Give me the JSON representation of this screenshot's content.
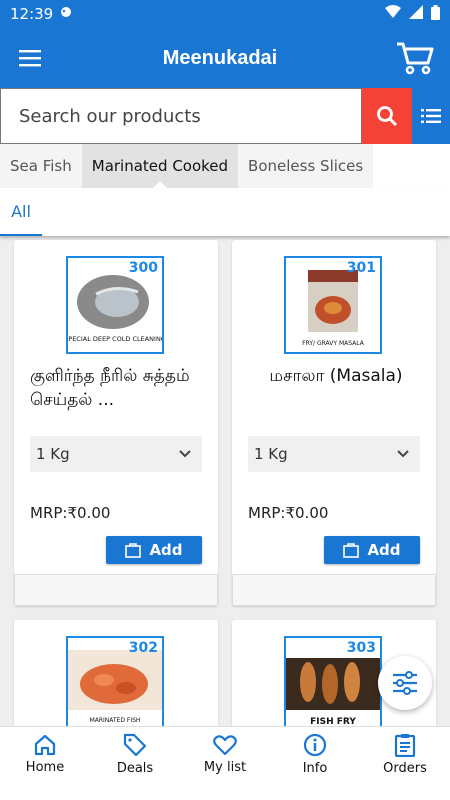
{
  "status": {
    "time": "12:39"
  },
  "app": {
    "title": "Meenukadai"
  },
  "search": {
    "placeholder": "Search our products"
  },
  "category_tabs": [
    {
      "label": "Sea Fish"
    },
    {
      "label": "Marinated Cooked"
    },
    {
      "label": "Boneless Slices"
    }
  ],
  "sub_tabs": [
    {
      "label": "All"
    }
  ],
  "products": [
    {
      "code": "300",
      "name": "குளிர்ந்த நீரில் சுத்தம் செய்தல் ...",
      "image_caption": "SPECIAL DEEP COLD CLEANING",
      "unit": "1 Kg",
      "mrp": "MRP:₹0.00",
      "add_label": "Add"
    },
    {
      "code": "301",
      "name": "மசாலா (Masala)",
      "image_caption": "FRY/ GRAVY MASALA",
      "unit": "1 Kg",
      "mrp": "MRP:₹0.00",
      "add_label": "Add"
    },
    {
      "code": "302",
      "name": "",
      "image_caption": "MARINATED FISH",
      "unit": "",
      "mrp": "",
      "add_label": ""
    },
    {
      "code": "303",
      "name": "",
      "image_caption": "FISH FRY",
      "unit": "",
      "mrp": "",
      "add_label": ""
    }
  ],
  "bottom_nav": [
    {
      "label": "Home",
      "icon": "home-icon"
    },
    {
      "label": "Deals",
      "icon": "tag-icon"
    },
    {
      "label": "My list",
      "icon": "heart-icon"
    },
    {
      "label": "Info",
      "icon": "info-icon"
    },
    {
      "label": "Orders",
      "icon": "clipboard-icon"
    }
  ],
  "colors": {
    "primary": "#1976d2",
    "search_button": "#f44336",
    "badge": "#1e88e5"
  }
}
